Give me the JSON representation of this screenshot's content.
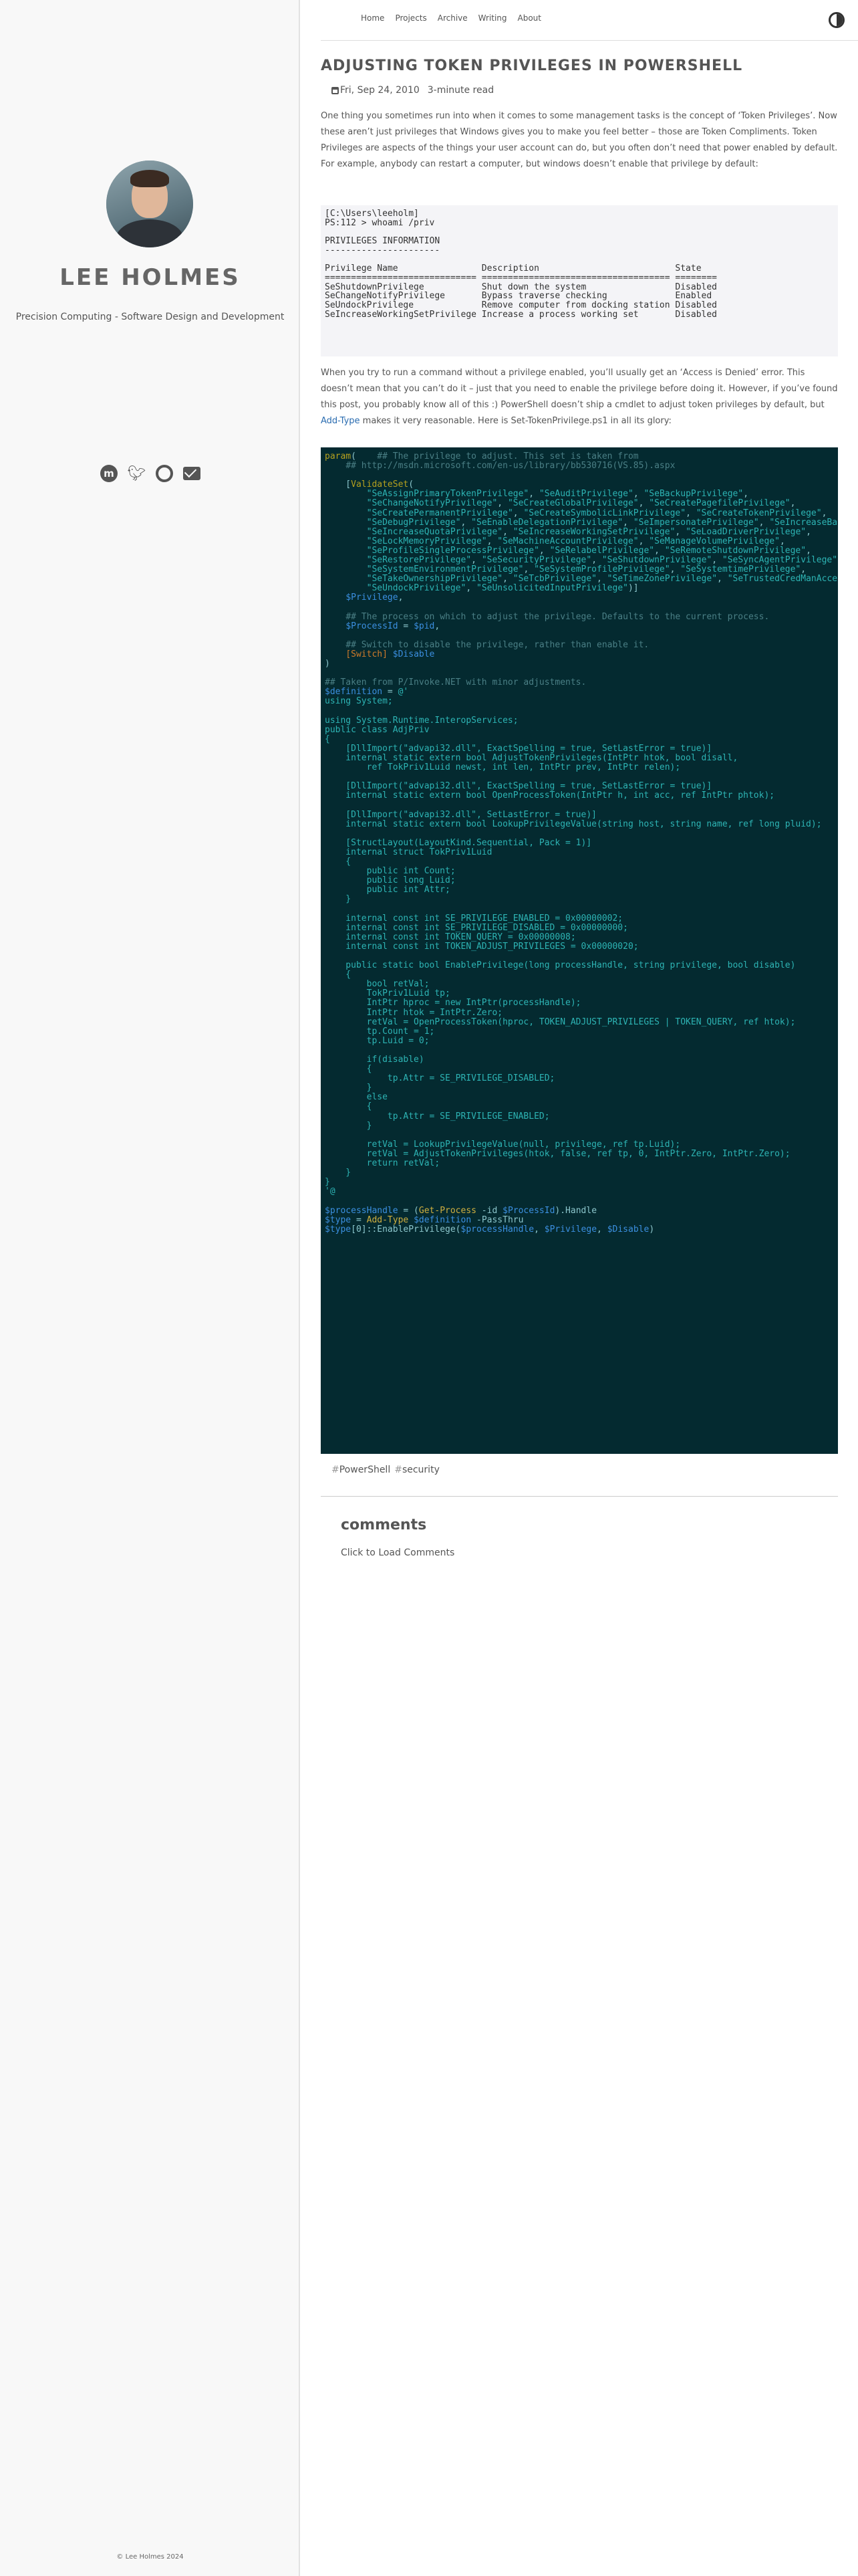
{
  "site": {
    "name": "LEE HOLMES",
    "tagline": "Precision Computing - Software Design and Development",
    "copyright": "© Lee Holmes 2024"
  },
  "social": [
    "mastodon-icon",
    "twitter-icon",
    "github-icon",
    "envelope-icon"
  ],
  "nav": {
    "items": [
      "Home",
      "Projects",
      "Archive",
      "Writing",
      "About"
    ]
  },
  "post": {
    "title": "ADJUSTING TOKEN PRIVILEGES IN POWERSHELL",
    "date": "Fri, Sep 24, 2010",
    "read_time": "3-minute read",
    "intro": "One thing you sometimes run into when it comes to some management tasks is the concept of ‘Token Privileges’. Now these aren’t just privileges that Windows gives you to make you feel better – those are Token Compliments. Token Privileges are aspects of the things your user account can do, but you often don’t need that power enabled by default. For example, anybody can restart a computer, but windows doesn’t enable that privilege by default:",
    "para2_before": "When you try to run a command without a privilege enabled, you’ll usually get an ‘Access is Denied’ error. This doesn’t mean that you can’t do it – just that you need to enable the privilege before doing it. However, if you’ve found this post, you probably know all of this :) PowerShell doesn’t ship a cmdlet to adjust token privileges by default, but ",
    "para2_link": "Add-Type",
    "para2_after": " makes it very reasonable. Here is Set-TokenPrivilege.ps1 in all its glory:",
    "tags": [
      "PowerShell",
      "security"
    ]
  },
  "code_whoami": "[C:\\Users\\leeholm]\nPS:112 > whoami /priv\n\nPRIVILEGES INFORMATION\n----------------------\n\nPrivilege Name                Description                          State\n============================= ==================================== ========\nSeShutdownPrivilege           Shut down the system                 Disabled\nSeChangeNotifyPrivilege       Bypass traverse checking             Enabled\nSeUndockPrivilege             Remove computer from docking station Disabled\nSeIncreaseWorkingSetPrivilege Increase a process working set       Disabled",
  "comments": {
    "heading": "comments",
    "load": "Click to Load Comments"
  }
}
